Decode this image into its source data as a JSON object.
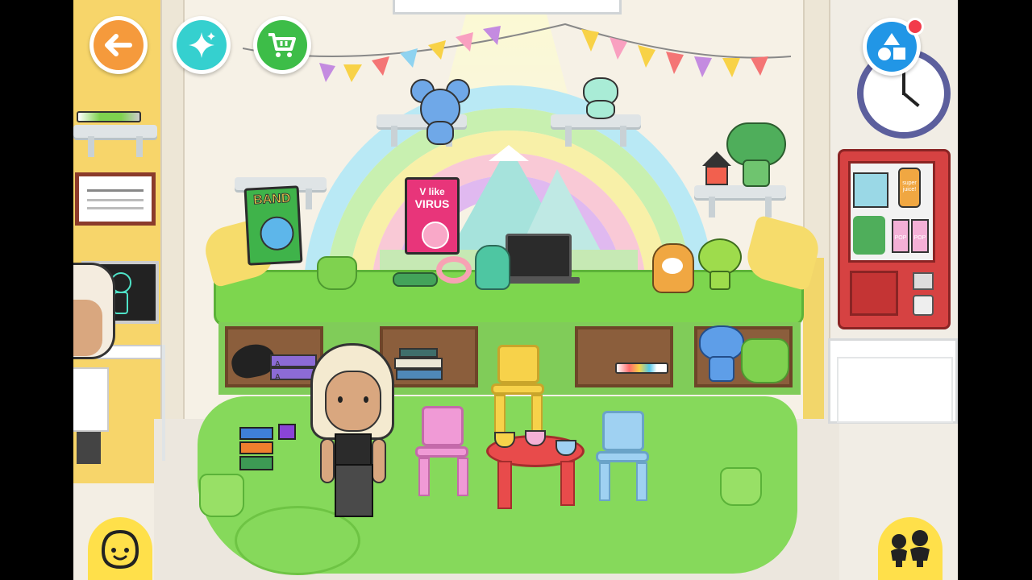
{
  "toolbar": {
    "back": {
      "icon": "back-arrow-icon",
      "color": "#f59a3c"
    },
    "magic": {
      "icon": "sparkle-icon",
      "color": "#35d0cf"
    },
    "shop": {
      "icon": "shopping-cart-icon",
      "color": "#3dbd48"
    },
    "create": {
      "icon": "shapes-icon",
      "color": "#2196e6"
    }
  },
  "scene": {
    "books": {
      "band": {
        "title": "BAND"
      },
      "virus": {
        "title_line1": "V like",
        "title_line2": "VIRUS"
      }
    },
    "vending": {
      "juice_label_line1": "super",
      "juice_label_line2": "juice!",
      "pop_label": "POP"
    },
    "toy_books": {
      "label": "A"
    }
  },
  "bottom": {
    "character_button": {
      "icon": "character-face-icon"
    },
    "family_button": {
      "icon": "family-icon"
    }
  }
}
